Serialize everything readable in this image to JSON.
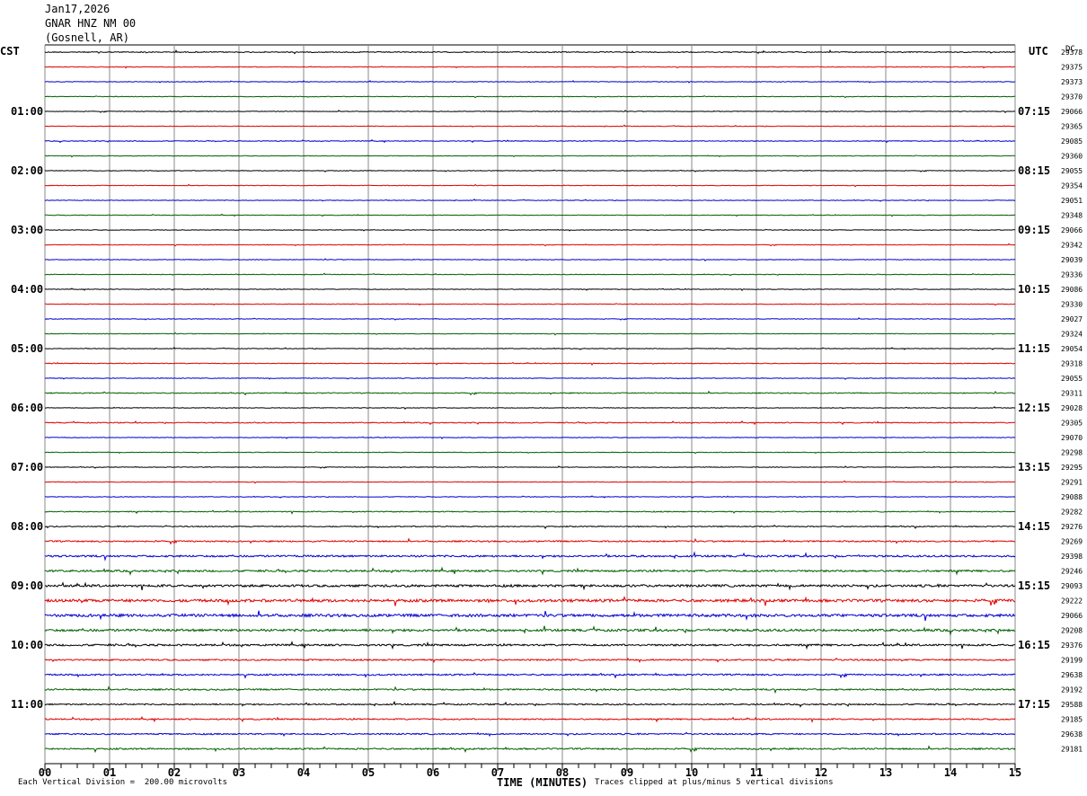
{
  "header": {
    "date": "Jan17,2026",
    "station": "GNAR HNZ NM 00",
    "location": "(Gosnell, AR)"
  },
  "left_zone_label": "CST",
  "right_zone_label": "UTC",
  "dc_label": "DC",
  "footer": {
    "scale_note": "Each Vertical Division =  200.00 microvolts",
    "clip_note": "Traces clipped at plus/minus 5 vertical divisions"
  },
  "colors": {
    "black": "#000000",
    "red": "#e00000",
    "blue": "#0000d0",
    "green": "#006000",
    "grid": "#888888"
  },
  "chart_data": {
    "type": "line",
    "xlabel": "TIME (MINUTES)",
    "x_ticks": [
      "00",
      "01",
      "02",
      "03",
      "04",
      "05",
      "06",
      "07",
      "08",
      "09",
      "10",
      "11",
      "12",
      "13",
      "14",
      "15"
    ],
    "xlim": [
      0,
      15
    ],
    "left_time_labels": [
      "01:00",
      "02:00",
      "03:00",
      "04:00",
      "05:00",
      "06:00",
      "07:00",
      "08:00",
      "09:00",
      "10:00",
      "11:00"
    ],
    "right_time_labels": [
      "07:15",
      "08:15",
      "09:15",
      "10:15",
      "11:15",
      "12:15",
      "13:15",
      "14:15",
      "15:15",
      "16:15",
      "17:15"
    ],
    "trace_colors": [
      "black",
      "red",
      "blue",
      "green"
    ],
    "trace_count": 48,
    "dc_offsets": [
      "29378",
      "29375",
      "29373",
      "29370",
      "29066",
      "29365",
      "29085",
      "29360",
      "29055",
      "29354",
      "29051",
      "29348",
      "29066",
      "29342",
      "29039",
      "29336",
      "29086",
      "29330",
      "29027",
      "29324",
      "29054",
      "29318",
      "29055",
      "29311",
      "29028",
      "29305",
      "29070",
      "29298",
      "29295",
      "29291",
      "29088",
      "29282",
      "29276",
      "29269",
      "29398",
      "29246",
      "29093",
      "29222",
      "29066",
      "29208",
      "29376",
      "29199",
      "29638",
      "29192",
      "29588",
      "29185",
      "29638",
      "29181"
    ],
    "amplitude_levels": [
      1,
      0.6,
      0.6,
      0.6,
      0.6,
      0.6,
      0.8,
      0.6,
      0.6,
      0.6,
      0.6,
      0.6,
      0.6,
      0.6,
      0.6,
      0.6,
      0.6,
      0.6,
      0.6,
      0.6,
      0.6,
      0.8,
      0.6,
      1,
      0.6,
      1,
      0.6,
      0.6,
      0.6,
      0.6,
      0.6,
      1,
      1,
      1.5,
      2,
      2,
      2.5,
      3,
      3,
      2.5,
      2,
      1.6,
      1.6,
      1.6,
      1.4,
      1.4,
      1.4,
      1.6
    ]
  }
}
